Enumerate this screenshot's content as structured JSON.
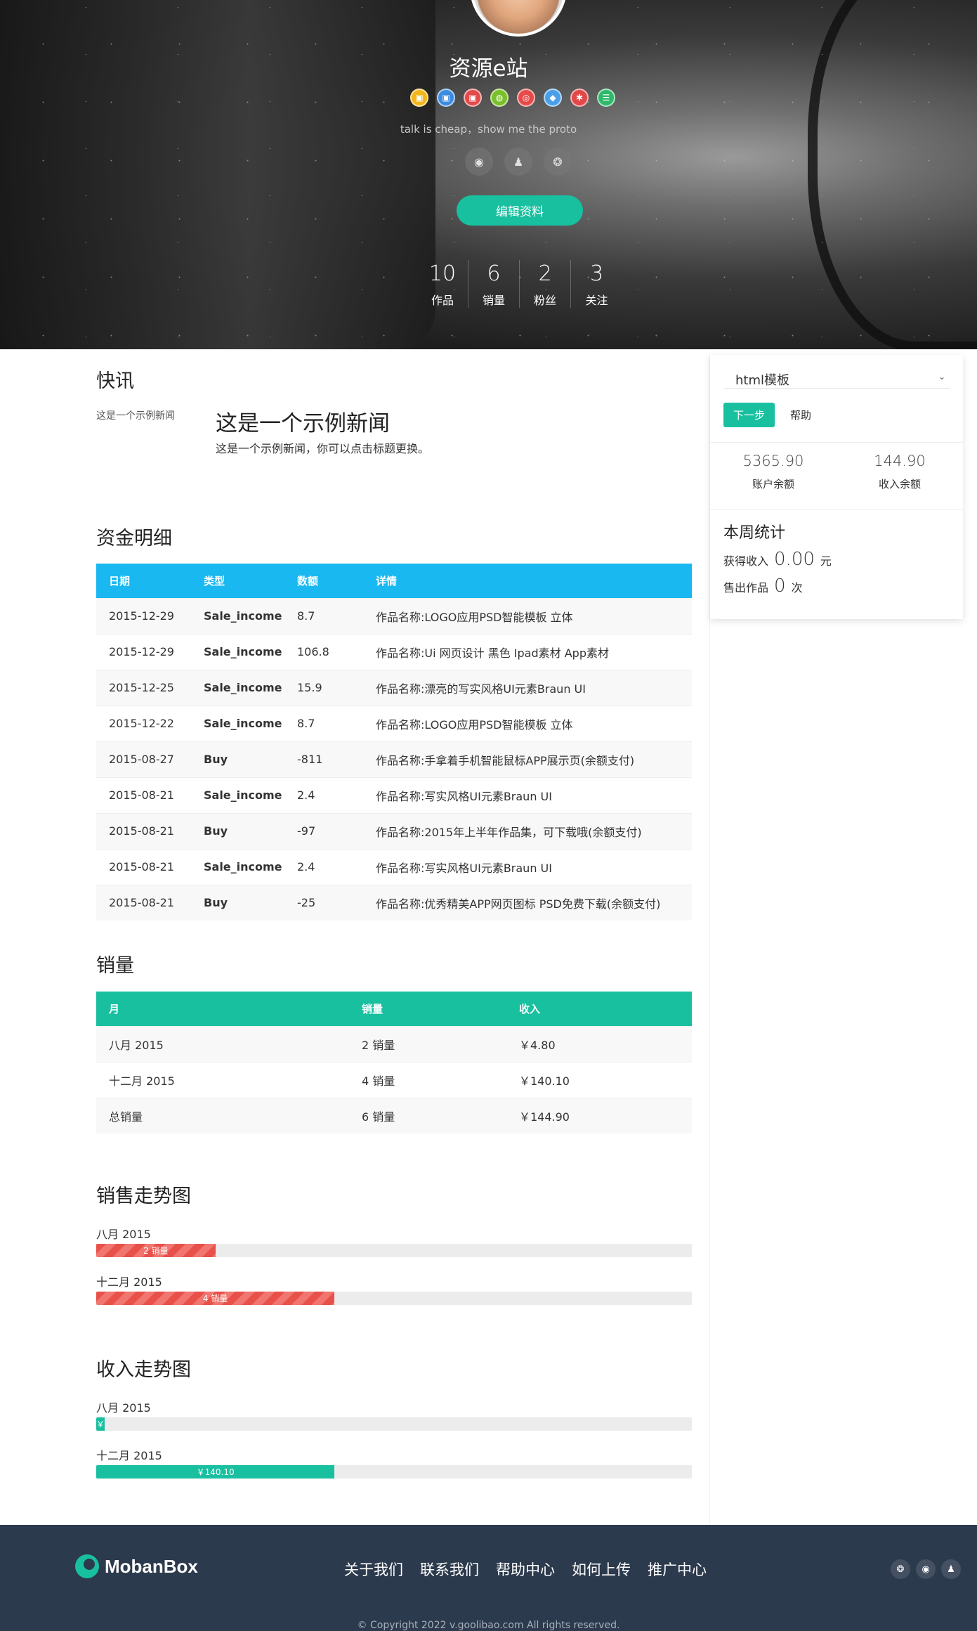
{
  "profile": {
    "site_name": "资源e站",
    "motto": "talk is cheap，show me the proto",
    "badges": [
      {
        "icon": "badge-yellow-icon",
        "color": "#f2b619",
        "glyph": "▣"
      },
      {
        "icon": "badge-blue-icon",
        "color": "#3b8be0",
        "glyph": "▣"
      },
      {
        "icon": "badge-red-icon",
        "color": "#e24b4b",
        "glyph": "▣"
      },
      {
        "icon": "badge-green-chip-icon",
        "color": "#7bbf2a",
        "glyph": "◍"
      },
      {
        "icon": "lifebuoy-icon",
        "color": "#e84a4a",
        "glyph": "◎"
      },
      {
        "icon": "cube-icon",
        "color": "#4aa0e8",
        "glyph": "◆"
      },
      {
        "icon": "gear-badge-icon",
        "color": "#e24848",
        "glyph": "✱"
      },
      {
        "icon": "menu-badge-icon",
        "color": "#2fb86a",
        "glyph": "☰"
      }
    ],
    "socials": [
      {
        "icon": "weibo-icon",
        "glyph": "◉"
      },
      {
        "icon": "qq-icon",
        "glyph": "♟"
      },
      {
        "icon": "wechat-icon",
        "glyph": "❂"
      }
    ],
    "edit_label": "编辑资料",
    "stats": [
      {
        "value": "10",
        "label": "作品"
      },
      {
        "value": "6",
        "label": "销量"
      },
      {
        "value": "2",
        "label": "粉丝"
      },
      {
        "value": "3",
        "label": "关注"
      }
    ]
  },
  "news": {
    "title": "快讯",
    "image_alt": "这是一个示例新闻",
    "item_title": "这是一个示例新闻",
    "item_desc": "这是一个示例新闻，你可以点击标题更换。"
  },
  "funds": {
    "title": "资金明细",
    "header_color": "#19b8f0",
    "columns": [
      "日期",
      "类型",
      "数额",
      "详情"
    ],
    "rows": [
      [
        "2015-12-29",
        "Sale_income",
        "8.7",
        "作品名称:LOGO应用PSD智能模板 立体"
      ],
      [
        "2015-12-29",
        "Sale_income",
        "106.8",
        "作品名称:Ui 网页设计 黑色 Ipad素材 App素材"
      ],
      [
        "2015-12-25",
        "Sale_income",
        "15.9",
        "作品名称:漂亮的写实风格UI元素Braun UI"
      ],
      [
        "2015-12-22",
        "Sale_income",
        "8.7",
        "作品名称:LOGO应用PSD智能模板 立体"
      ],
      [
        "2015-08-27",
        "Buy",
        "-811",
        "作品名称:手拿着手机智能鼠标APP展示页(余额支付)"
      ],
      [
        "2015-08-21",
        "Sale_income",
        "2.4",
        "作品名称:写实风格UI元素Braun UI"
      ],
      [
        "2015-08-21",
        "Buy",
        "-97",
        "作品名称:2015年上半年作品集，可下载哦(余额支付)"
      ],
      [
        "2015-08-21",
        "Sale_income",
        "2.4",
        "作品名称:写实风格UI元素Braun UI"
      ],
      [
        "2015-08-21",
        "Buy",
        "-25",
        "作品名称:优秀精美APP网页图标 PSD免费下载(余额支付)"
      ]
    ]
  },
  "sales": {
    "title": "销量",
    "header_color": "#19c0a0",
    "columns": [
      "月",
      "销量",
      "收入"
    ],
    "rows": [
      [
        "八月 2015",
        "2 销量",
        "￥4.80"
      ],
      [
        "十二月 2015",
        "4 销量",
        "￥140.10"
      ],
      [
        "总销量",
        "6 销量",
        "￥144.90"
      ]
    ]
  },
  "sales_trend": {
    "title": "销售走势图",
    "bars": [
      {
        "label": "八月 2015",
        "text": "2 销量",
        "fraction": 0.2
      },
      {
        "label": "十二月 2015",
        "text": "4 销量",
        "fraction": 0.4
      }
    ]
  },
  "income_trend": {
    "title": "收入走势图",
    "bars": [
      {
        "label": "八月 2015",
        "text": "￥",
        "fraction": 0.014
      },
      {
        "label": "十二月 2015",
        "text": "￥140.10",
        "fraction": 0.4
      }
    ]
  },
  "sidebar": {
    "select_value": "html模板",
    "next_label": "下一步",
    "help_label": "帮助",
    "balances": [
      {
        "value": "5365.90",
        "label": "账户余额"
      },
      {
        "value": "144.90",
        "label": "收入余额"
      }
    ],
    "week_title": "本周统计",
    "income_label": "获得收入",
    "income_value": "0.00",
    "income_unit": "元",
    "sold_label": "售出作品",
    "sold_value": "0",
    "sold_unit": "次"
  },
  "footer": {
    "logo_text": "MobanBox",
    "nav": [
      "关于我们",
      "联系我们",
      "帮助中心",
      "如何上传",
      "推广中心"
    ],
    "socials": [
      {
        "icon": "wechat-icon",
        "glyph": "❂"
      },
      {
        "icon": "weibo-icon",
        "glyph": "◉"
      },
      {
        "icon": "qq-icon",
        "glyph": "♟"
      }
    ],
    "copyright": "© Copyright 2022 v.goolibao.com All rights reserved."
  }
}
